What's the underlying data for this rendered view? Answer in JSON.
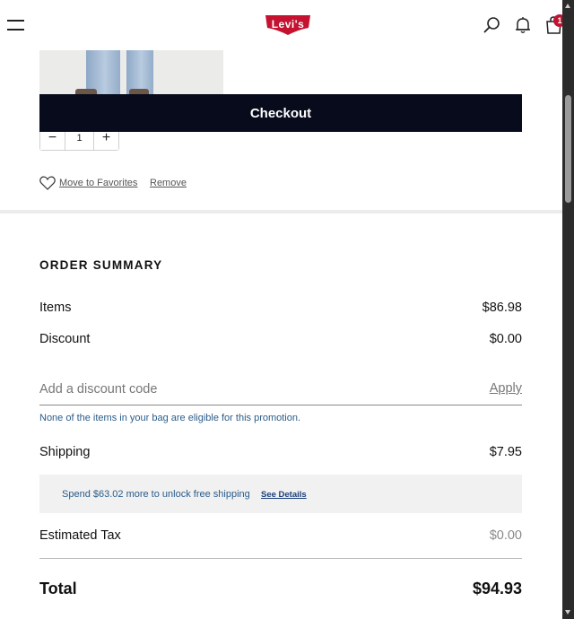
{
  "header": {
    "logo_text": "Levi's",
    "bag_count": "1",
    "brand_color": "#c41230"
  },
  "cart_item": {
    "checkout_label": "Checkout",
    "quantity": "1",
    "move_to_favorites_label": "Move to Favorites",
    "remove_label": "Remove"
  },
  "order_summary": {
    "title": "ORDER SUMMARY",
    "items_label": "Items",
    "items_value": "$86.98",
    "discount_label": "Discount",
    "discount_value": "$0.00",
    "discount_code_placeholder": "Add a discount code",
    "apply_label": "Apply",
    "promo_message": "None of the items in your bag are eligible for this promotion.",
    "shipping_label": "Shipping",
    "shipping_value": "$7.95",
    "free_shipping_message": "Spend $63.02 more to unlock free shipping",
    "see_details_label": "See Details",
    "estimated_tax_label": "Estimated Tax",
    "estimated_tax_value": "$0.00",
    "total_label": "Total",
    "total_value": "$94.93"
  },
  "icons": {
    "menu": "hamburger-menu-icon",
    "search": "search-icon",
    "notifications": "bell-icon",
    "bag": "shopping-bag-icon",
    "favorite": "heart-icon"
  }
}
